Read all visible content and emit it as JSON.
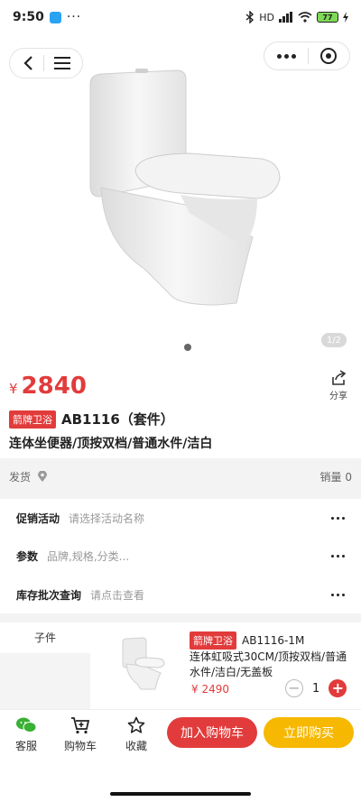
{
  "status_bar": {
    "time": "9:50",
    "more": "···",
    "net_label": "HD",
    "battery": "77"
  },
  "gallery": {
    "page_counter": "1/2"
  },
  "product": {
    "price_symbol": "¥",
    "price": "2840",
    "brand_tag": "箭牌卫浴",
    "model": "AB1116（套件）",
    "description": "连体坐便器/顶按双档/普通水件/洁白",
    "share_label": "分享"
  },
  "shipping": {
    "label": "发货",
    "sales": "销量 0"
  },
  "options": [
    {
      "label": "促销活动",
      "placeholder": "请选择活动名称"
    },
    {
      "label": "参数",
      "placeholder": "品牌,规格,分类..."
    },
    {
      "label": "库存批次查询",
      "placeholder": "请点击查看"
    }
  ],
  "sub_item": {
    "section_label": "子件",
    "brand_tag": "箭牌卫浴",
    "model": "AB1116-1M",
    "description": "连体虹吸式30CM/顶按双档/普通水件/洁白/无盖板",
    "price": "¥ 2490",
    "quantity": "1",
    "minus": "−",
    "plus": "+"
  },
  "bottom_bar": {
    "service": "客服",
    "cart": "购物车",
    "favorite": "收藏",
    "add_to_cart": "加入购物车",
    "buy_now": "立即购买"
  },
  "colors": {
    "accent_red": "#e23b3b",
    "buy_yellow": "#f6b800"
  }
}
